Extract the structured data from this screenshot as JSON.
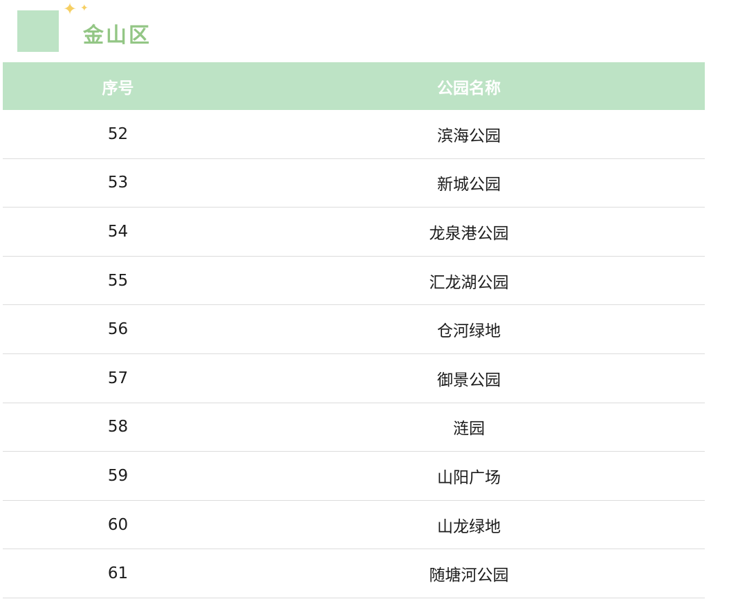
{
  "section": {
    "title": "金山区",
    "accent_color": "#bde3c5",
    "title_color": "#93c685",
    "sparkle_color": "#f6cf63",
    "sparkle_icon": "sparkle-icon"
  },
  "table": {
    "columns": [
      "序号",
      "公园名称"
    ],
    "rows": [
      {
        "index": "52",
        "name": "滨海公园"
      },
      {
        "index": "53",
        "name": "新城公园"
      },
      {
        "index": "54",
        "name": "龙泉港公园"
      },
      {
        "index": "55",
        "name": "汇龙湖公园"
      },
      {
        "index": "56",
        "name": "仓河绿地"
      },
      {
        "index": "57",
        "name": "御景公园"
      },
      {
        "index": "58",
        "name": "涟园"
      },
      {
        "index": "59",
        "name": "山阳广场"
      },
      {
        "index": "60",
        "name": "山龙绿地"
      },
      {
        "index": "61",
        "name": "随塘河公园"
      }
    ]
  }
}
